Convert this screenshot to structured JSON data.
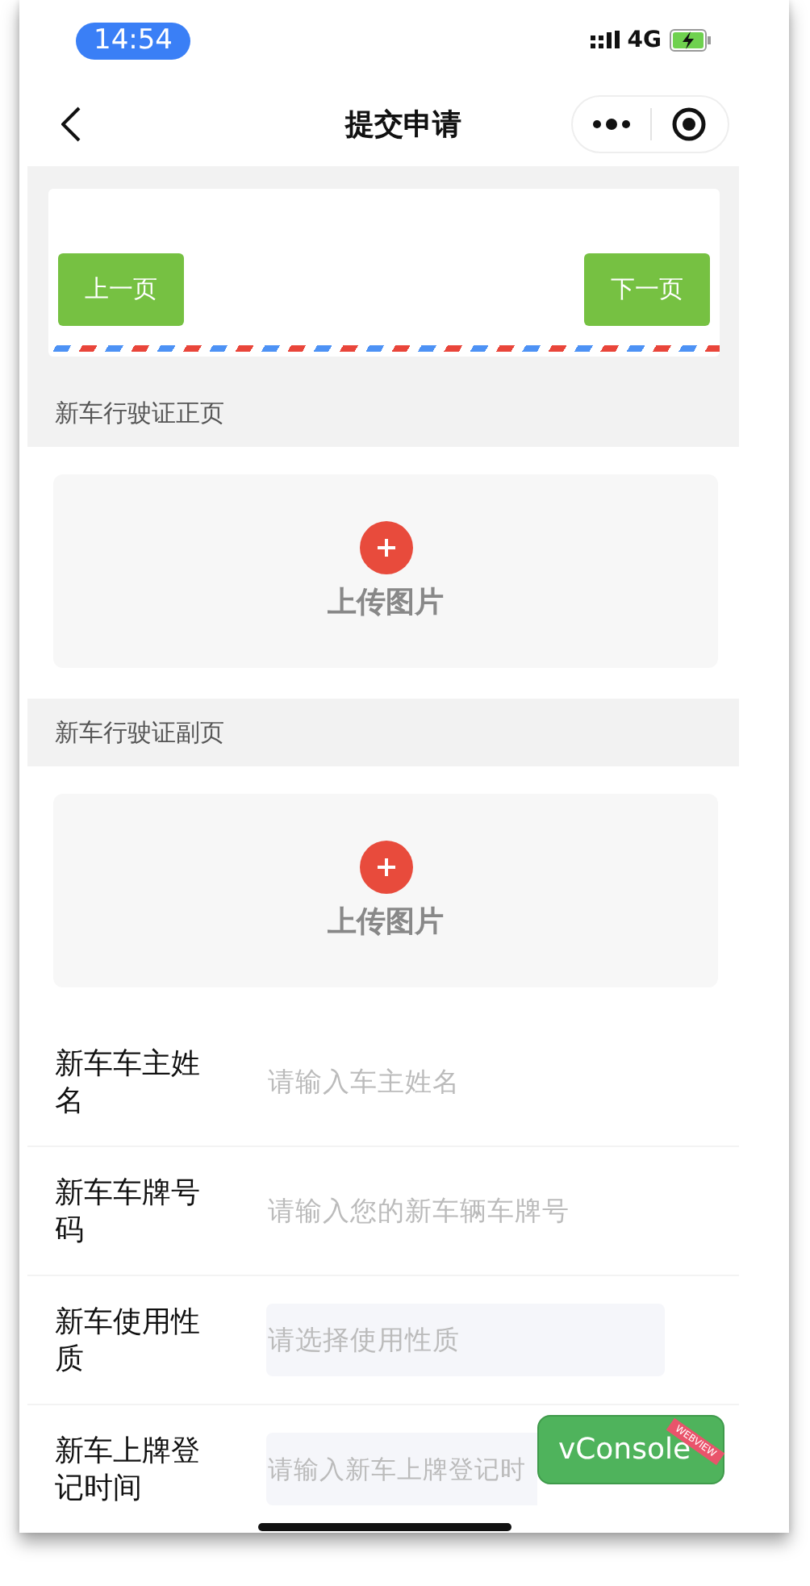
{
  "status_bar": {
    "time": "14:54",
    "network": "4G"
  },
  "nav": {
    "title": "提交申请"
  },
  "pager": {
    "buttons": [
      {
        "label": "上一页"
      },
      {
        "label": "下一页"
      }
    ]
  },
  "sections": [
    {
      "title": "新车行驶证正页",
      "upload_label": "上传图片"
    },
    {
      "title": "新车行驶证副页",
      "upload_label": "上传图片"
    }
  ],
  "form": [
    {
      "kind": "text",
      "label": "新车车主姓名",
      "placeholder": "请输入车主姓名"
    },
    {
      "kind": "text",
      "label": "新车车牌号码",
      "placeholder": "请输入您的新车辆车牌号"
    },
    {
      "kind": "picker",
      "label": "新车使用性质",
      "placeholder": "请选择使用性质"
    },
    {
      "kind": "picker",
      "label": "新车上牌登记时间",
      "placeholder": "请输入新车上牌登记时"
    }
  ],
  "debug_button": {
    "label": "vConsole",
    "ribbon": "WEBVIEW"
  }
}
